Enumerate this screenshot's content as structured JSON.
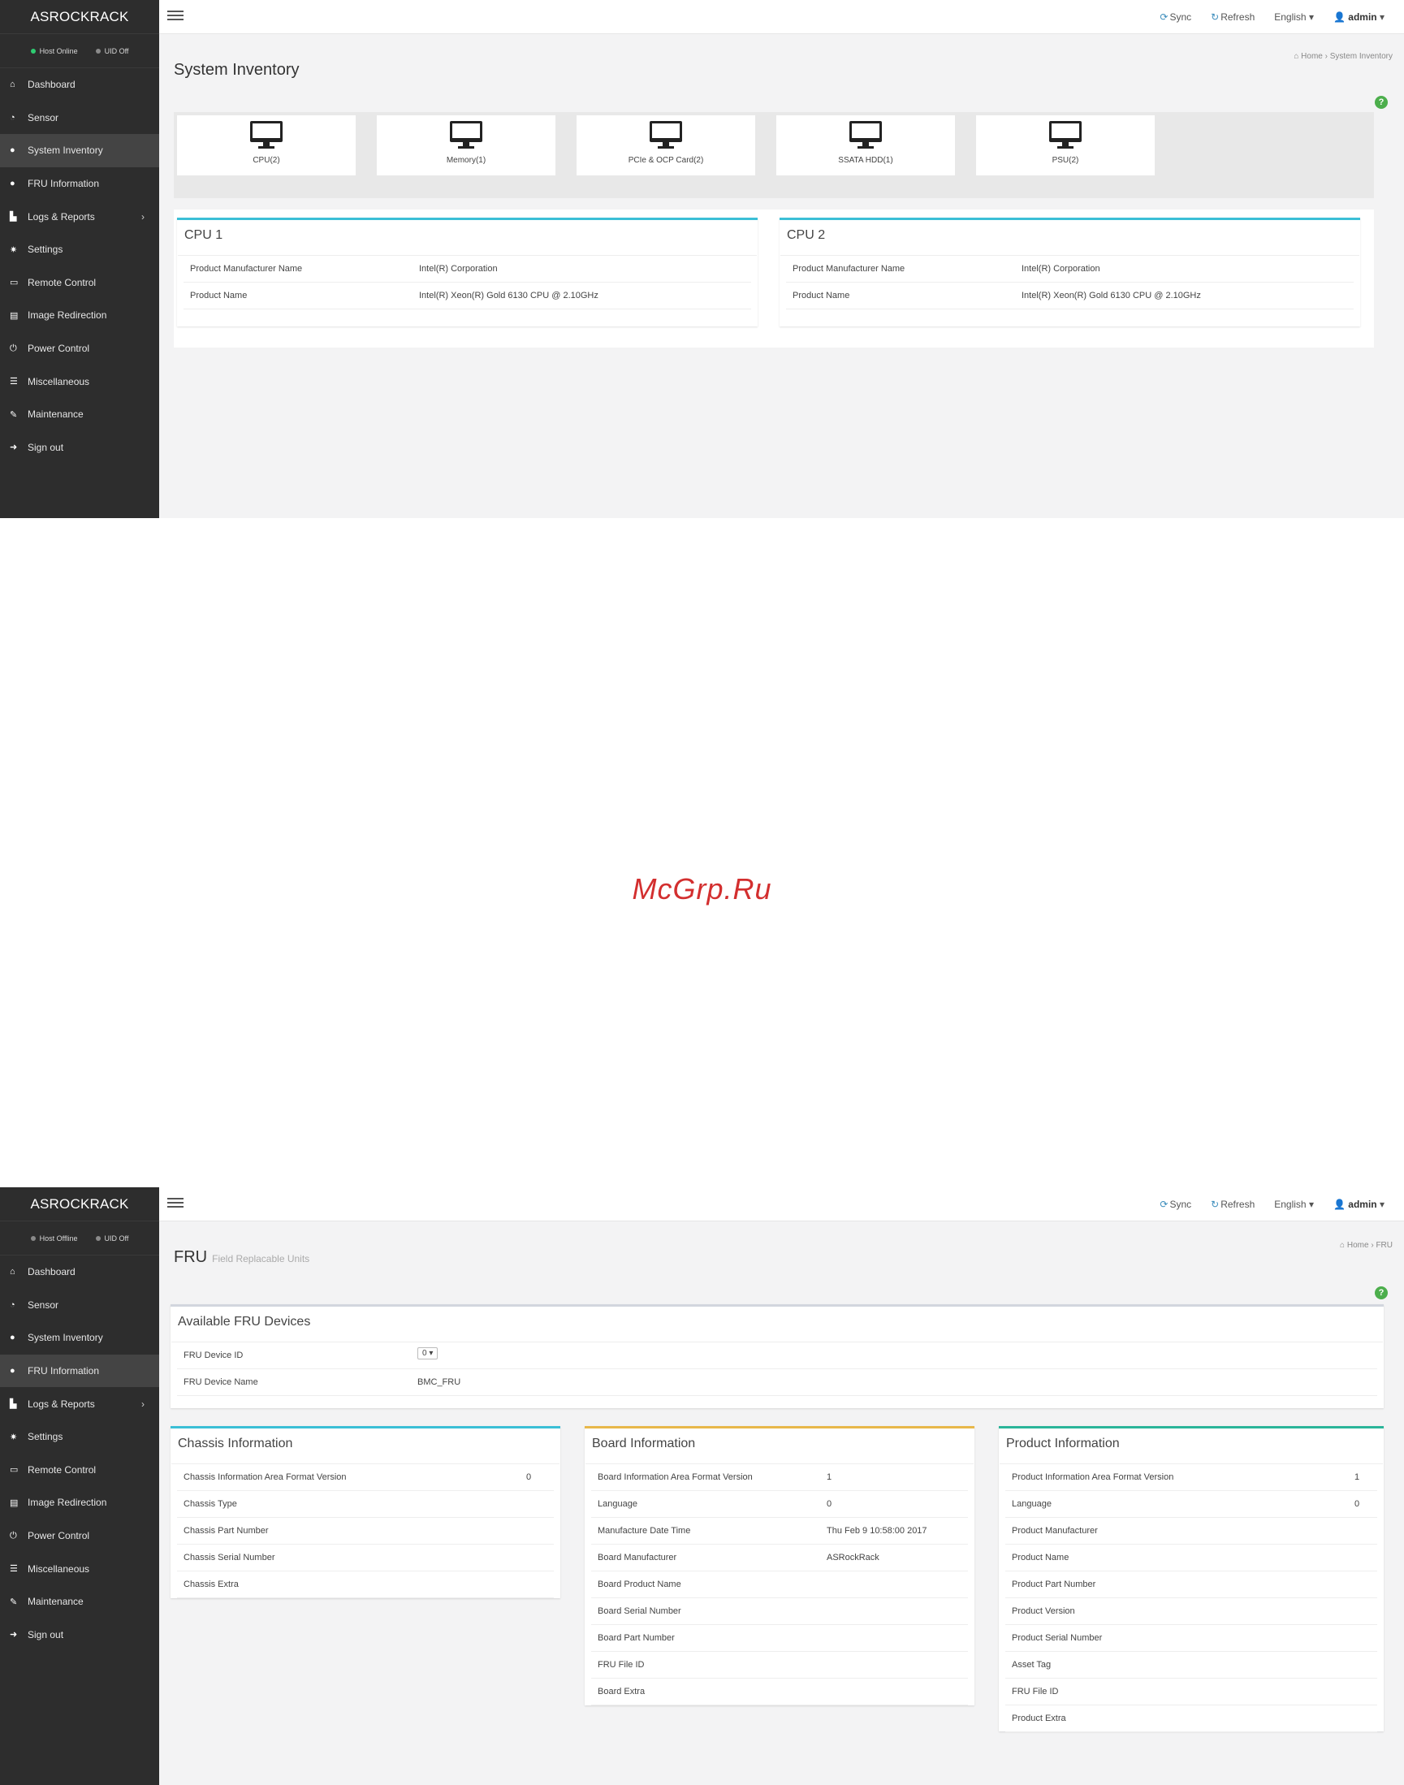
{
  "screen1": {
    "brand": "ASROCKRACK",
    "status": {
      "host": "Host Online",
      "uid": "UID Off",
      "host_color": "#2ecc71",
      "uid_color": "#8a8a8a"
    },
    "nav": [
      {
        "label": "Dashboard",
        "icon": "home-icon"
      },
      {
        "label": "Sensor",
        "icon": "tachometer-icon"
      },
      {
        "label": "System Inventory",
        "icon": "info-circle-icon",
        "active": true
      },
      {
        "label": "FRU Information",
        "icon": "info-circle-icon"
      },
      {
        "label": "Logs & Reports",
        "icon": "bar-chart-icon"
      },
      {
        "label": "Settings",
        "icon": "gear-icon"
      },
      {
        "label": "Remote Control",
        "icon": "desktop-icon"
      },
      {
        "label": "Image Redirection",
        "icon": "hdd-icon"
      },
      {
        "label": "Power Control",
        "icon": "power-icon"
      },
      {
        "label": "Miscellaneous",
        "icon": "list-icon"
      },
      {
        "label": "Maintenance",
        "icon": "wrench-icon"
      },
      {
        "label": "Sign out",
        "icon": "sign-out-icon"
      }
    ],
    "top": {
      "sync": "Sync",
      "refresh": "Refresh",
      "language": "English",
      "user": "admin"
    },
    "title": "System Inventory",
    "breadcrumb": {
      "home": "Home",
      "current": "System Inventory"
    },
    "tiles": [
      "CPU(2)",
      "Memory(1)",
      "PCIe & OCP Card(2)",
      "SSATA HDD(1)",
      "PSU(2)"
    ],
    "cpu1": {
      "title": "CPU 1",
      "rows": [
        {
          "k": "Product Manufacturer Name",
          "v": "Intel(R) Corporation"
        },
        {
          "k": "Product Name",
          "v": "Intel(R) Xeon(R) Gold 6130 CPU @ 2.10GHz"
        }
      ]
    },
    "cpu2": {
      "title": "CPU 2",
      "rows": [
        {
          "k": "Product Manufacturer Name",
          "v": "Intel(R) Corporation"
        },
        {
          "k": "Product Name",
          "v": "Intel(R) Xeon(R) Gold 6130 CPU @ 2.10GHz"
        }
      ]
    }
  },
  "watermark": "McGrp.Ru",
  "screen2": {
    "brand": "ASROCKRACK",
    "status": {
      "host": "Host Offline",
      "uid": "UID Off",
      "host_color": "#8a8a8a",
      "uid_color": "#8a8a8a"
    },
    "nav": [
      {
        "label": "Dashboard",
        "icon": "home-icon"
      },
      {
        "label": "Sensor",
        "icon": "tachometer-icon"
      },
      {
        "label": "System Inventory",
        "icon": "info-circle-icon"
      },
      {
        "label": "FRU Information",
        "icon": "info-circle-icon",
        "active": true
      },
      {
        "label": "Logs & Reports",
        "icon": "bar-chart-icon"
      },
      {
        "label": "Settings",
        "icon": "gear-icon"
      },
      {
        "label": "Remote Control",
        "icon": "desktop-icon"
      },
      {
        "label": "Image Redirection",
        "icon": "hdd-icon"
      },
      {
        "label": "Power Control",
        "icon": "power-icon"
      },
      {
        "label": "Miscellaneous",
        "icon": "list-icon"
      },
      {
        "label": "Maintenance",
        "icon": "wrench-icon"
      },
      {
        "label": "Sign out",
        "icon": "sign-out-icon"
      }
    ],
    "top": {
      "sync": "Sync",
      "refresh": "Refresh",
      "language": "English",
      "user": "admin"
    },
    "title": "FRU",
    "subtitle": "Field Replacable Units",
    "breadcrumb": {
      "home": "Home",
      "current": "FRU"
    },
    "available": {
      "title": "Available FRU Devices",
      "device_id_label": "FRU Device ID",
      "device_id_value": "0",
      "device_name_label": "FRU Device Name",
      "device_name_value": "BMC_FRU"
    },
    "chassis": {
      "title": "Chassis Information",
      "rows": [
        {
          "k": "Chassis Information Area Format Version",
          "v": "0"
        },
        {
          "k": "Chassis Type",
          "v": ""
        },
        {
          "k": "Chassis Part Number",
          "v": ""
        },
        {
          "k": "Chassis Serial Number",
          "v": ""
        },
        {
          "k": "Chassis Extra",
          "v": ""
        }
      ]
    },
    "board": {
      "title": "Board Information",
      "rows": [
        {
          "k": "Board Information Area Format Version",
          "v": "1"
        },
        {
          "k": "Language",
          "v": "0"
        },
        {
          "k": "Manufacture Date Time",
          "v": "Thu Feb 9 10:58:00 2017"
        },
        {
          "k": "Board Manufacturer",
          "v": "ASRockRack"
        },
        {
          "k": "Board Product Name",
          "v": ""
        },
        {
          "k": "Board Serial Number",
          "v": ""
        },
        {
          "k": "Board Part Number",
          "v": ""
        },
        {
          "k": "FRU File ID",
          "v": ""
        },
        {
          "k": "Board Extra",
          "v": ""
        }
      ]
    },
    "product": {
      "title": "Product Information",
      "rows": [
        {
          "k": "Product Information Area Format Version",
          "v": "1"
        },
        {
          "k": "Language",
          "v": "0"
        },
        {
          "k": "Product Manufacturer",
          "v": ""
        },
        {
          "k": "Product Name",
          "v": ""
        },
        {
          "k": "Product Part Number",
          "v": ""
        },
        {
          "k": "Product Version",
          "v": ""
        },
        {
          "k": "Product Serial Number",
          "v": ""
        },
        {
          "k": "Asset Tag",
          "v": ""
        },
        {
          "k": "FRU File ID",
          "v": ""
        },
        {
          "k": "Product Extra",
          "v": ""
        }
      ]
    }
  }
}
